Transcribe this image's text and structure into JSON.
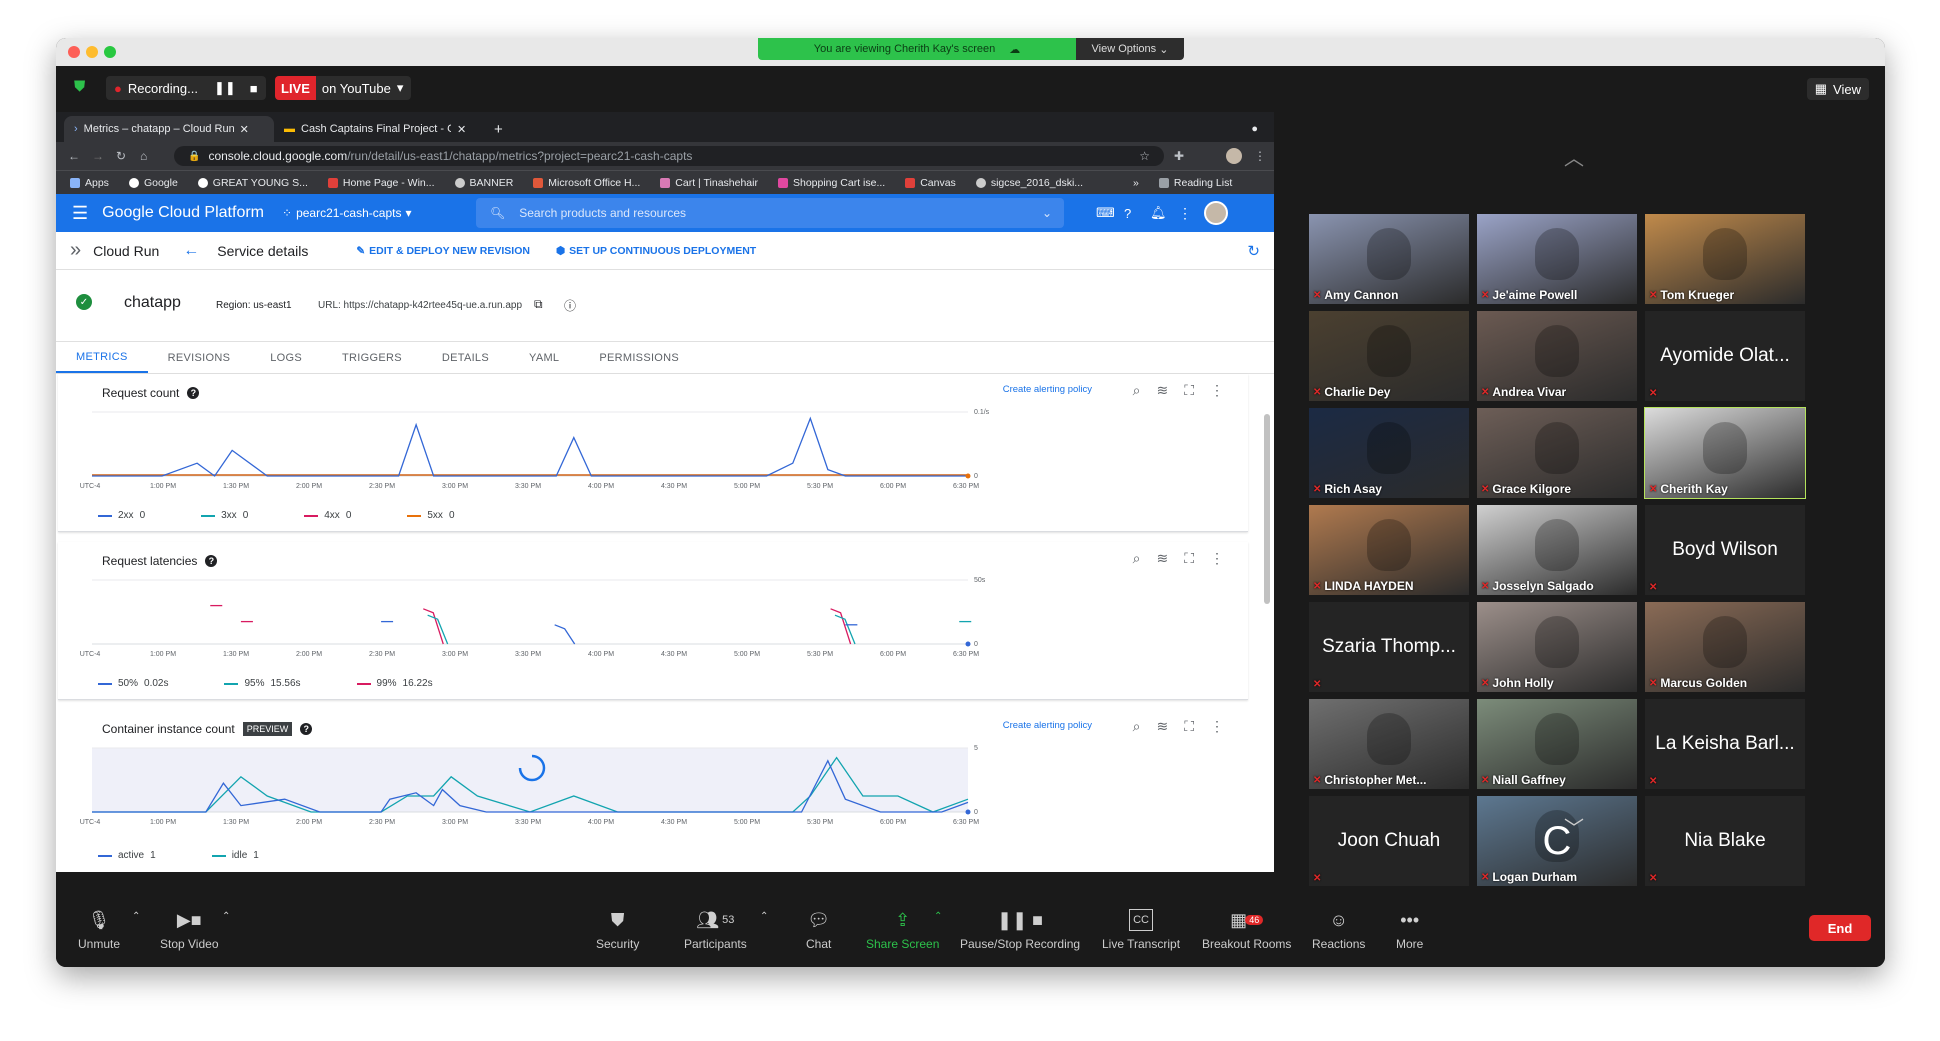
{
  "share_banner": {
    "text": "You are viewing Cherith Kay's screen",
    "view_options": "View Options"
  },
  "zoom_top": {
    "recording": "Recording...",
    "live": "LIVE",
    "on_platform": "on YouTube",
    "view": "View"
  },
  "browser": {
    "tabs": [
      {
        "label": "Metrics – chatapp – Cloud Run"
      },
      {
        "label": "Cash Captains Final Project - G"
      }
    ],
    "url_host": "console.cloud.google.com",
    "url_path": "/run/detail/us-east1/chatapp/metrics?project=pearc21-cash-capts",
    "bookmarks": [
      "Apps",
      "Google",
      "GREAT YOUNG S...",
      "Home Page - Win...",
      "BANNER",
      "Microsoft Office H...",
      "Cart | Tinashehair",
      "Shopping Cart ise...",
      "Canvas",
      "sigcse_2016_dski..."
    ],
    "reading_list": "Reading List"
  },
  "gcp": {
    "brand": "Google Cloud Platform",
    "project": "pearc21-cash-capts",
    "search_placeholder": "Search products and resources",
    "product": "Cloud Run",
    "page_title": "Service details",
    "edit_deploy": "EDIT & DEPLOY NEW REVISION",
    "continuous": "SET UP CONTINUOUS DEPLOYMENT",
    "service_name": "chatapp",
    "region": "Region: us-east1",
    "url": "URL: https://chatapp-k42rtee45q-ue.a.run.app",
    "tabs": [
      "METRICS",
      "REVISIONS",
      "LOGS",
      "TRIGGERS",
      "DETAILS",
      "YAML",
      "PERMISSIONS"
    ]
  },
  "x_ticks": [
    "UTC-4",
    "1:00 PM",
    "1:30 PM",
    "2:00 PM",
    "2:30 PM",
    "3:00 PM",
    "3:30 PM",
    "4:00 PM",
    "4:30 PM",
    "5:00 PM",
    "5:30 PM",
    "6:00 PM",
    "6:30 PM"
  ],
  "chart_data": [
    {
      "type": "line",
      "title": "Request count",
      "alert_link": "Create alerting policy",
      "ymax_label": "0.1/s",
      "ymin_label": "0",
      "series": [
        {
          "name": "2xx",
          "current": "0",
          "color": "#3367d6"
        },
        {
          "name": "3xx",
          "current": "0",
          "color": "#12a4af"
        },
        {
          "name": "4xx",
          "current": "0",
          "color": "#d81b60"
        },
        {
          "name": "5xx",
          "current": "0",
          "color": "#e8710a"
        }
      ],
      "x": [
        0,
        0.08,
        0.12,
        0.14,
        0.16,
        0.2,
        0.3,
        0.35,
        0.37,
        0.39,
        0.42,
        0.5,
        0.53,
        0.55,
        0.57,
        0.6,
        0.7,
        0.77,
        0.8,
        0.82,
        0.84,
        0.86,
        0.9,
        1.0
      ],
      "values_2xx": [
        0,
        0,
        0.02,
        0,
        0.04,
        0,
        0,
        0,
        0.08,
        0,
        0,
        0,
        0,
        0.06,
        0,
        0,
        0,
        0,
        0.02,
        0.09,
        0.01,
        0,
        0,
        0
      ]
    },
    {
      "type": "line",
      "title": "Request latencies",
      "ymax_label": "50s",
      "ymin_label": "0",
      "series": [
        {
          "name": "50%",
          "current": "0.02s",
          "color": "#3367d6"
        },
        {
          "name": "95%",
          "current": "15.56s",
          "color": "#12a4af"
        },
        {
          "name": "99%",
          "current": "16.22s",
          "color": "#d81b60"
        }
      ]
    },
    {
      "type": "area",
      "title": "Container instance count",
      "badge": "PREVIEW",
      "alert_link": "Create alerting policy",
      "ymax_label": "5",
      "ymin_label": "0",
      "series": [
        {
          "name": "active",
          "current": "1",
          "color": "#3367d6"
        },
        {
          "name": "idle",
          "current": "1",
          "color": "#12a4af"
        }
      ]
    }
  ],
  "participants": [
    {
      "name": "Amy Cannon",
      "video": true,
      "bg": "#8a94b0"
    },
    {
      "name": "Je'aime Powell",
      "video": true,
      "bg": "#9aa3c7"
    },
    {
      "name": "Tom Krueger",
      "video": true,
      "bg": "#c08a4b"
    },
    {
      "name": "Charlie Dey",
      "video": true,
      "bg": "#4b4030"
    },
    {
      "name": "Andrea Vivar",
      "video": true,
      "bg": "#6b5a52"
    },
    {
      "name": "Ayomide Olat...",
      "video": false
    },
    {
      "name": "Rich Asay",
      "video": true,
      "bg": "#1b2a44"
    },
    {
      "name": "Grace Kilgore",
      "video": true,
      "bg": "#6d5e57"
    },
    {
      "name": "Cherith Kay",
      "video": true,
      "bg": "#dcdcdc"
    },
    {
      "name": "LINDA HAYDEN",
      "video": true,
      "bg": "#b07a4f"
    },
    {
      "name": "Josselyn Salgado",
      "video": true,
      "bg": "#d0d0d0"
    },
    {
      "name": "Boyd Wilson",
      "video": false
    },
    {
      "name": "Szaria Thomp...",
      "video": false
    },
    {
      "name": "John Holly",
      "video": true,
      "bg": "#9c8f8a"
    },
    {
      "name": "Marcus Golden",
      "video": true,
      "bg": "#8a6b56"
    },
    {
      "name": "Christopher Met...",
      "video": true,
      "bg": "#6f6f6f"
    },
    {
      "name": "Niall Gaffney",
      "video": true,
      "bg": "#7c8c7a"
    },
    {
      "name": "La Keisha Barl...",
      "video": false
    },
    {
      "name": "Joon Chuah",
      "video": false
    },
    {
      "name": "Logan Durham",
      "video": true,
      "bg": "#5d7891",
      "letter": "C"
    },
    {
      "name": "Nia Blake",
      "video": false
    }
  ],
  "toolbar": {
    "unmute": "Unmute",
    "stop_video": "Stop Video",
    "security": "Security",
    "participants": "Participants",
    "participant_count": "53",
    "chat": "Chat",
    "share": "Share Screen",
    "pause": "Pause/Stop Recording",
    "transcript": "Live Transcript",
    "breakout": "Breakout Rooms",
    "breakout_badge": "46",
    "reactions": "Reactions",
    "more": "More",
    "end": "End"
  }
}
